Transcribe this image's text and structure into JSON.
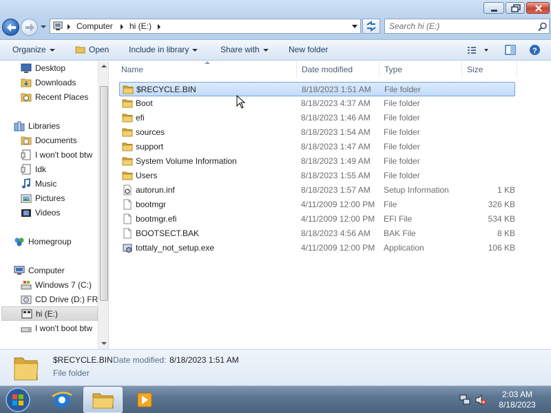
{
  "window": {
    "minimize_icon": "minimize-icon",
    "maximize_icon": "maximize-icon",
    "close_icon": "close-icon"
  },
  "address": {
    "crumbs": [
      "Computer",
      "hi (E:)"
    ],
    "search_placeholder": "Search hi (E:)"
  },
  "toolbar": {
    "organize": "Organize",
    "open": "Open",
    "include_in_library": "Include in library",
    "share_with": "Share with",
    "new_folder": "New folder"
  },
  "nav": {
    "favorites": [
      "Desktop",
      "Downloads",
      "Recent Places"
    ],
    "libraries_label": "Libraries",
    "libraries": [
      "Documents",
      "I won't boot btw",
      "Idk",
      "Music",
      "Pictures",
      "Videos"
    ],
    "homegroup": "Homegroup",
    "computer_label": "Computer",
    "drives": [
      "Windows 7 (C:)",
      "CD Drive (D:) FRT",
      "hi (E:)",
      "I won't boot btw"
    ],
    "selected_drive": "hi (E:)"
  },
  "columns": {
    "name": "Name",
    "date_modified": "Date modified",
    "type": "Type",
    "size": "Size"
  },
  "files": [
    {
      "name": "$RECYCLE.BIN",
      "date": "8/18/2023 1:51 AM",
      "type": "File folder",
      "size": "",
      "icon": "folder-icon"
    },
    {
      "name": "Boot",
      "date": "8/18/2023 4:37 AM",
      "type": "File folder",
      "size": "",
      "icon": "folder-icon"
    },
    {
      "name": "efi",
      "date": "8/18/2023 1:46 AM",
      "type": "File folder",
      "size": "",
      "icon": "folder-icon"
    },
    {
      "name": "sources",
      "date": "8/18/2023 1:54 AM",
      "type": "File folder",
      "size": "",
      "icon": "folder-icon"
    },
    {
      "name": "support",
      "date": "8/18/2023 1:47 AM",
      "type": "File folder",
      "size": "",
      "icon": "folder-icon"
    },
    {
      "name": "System Volume Information",
      "date": "8/18/2023 1:49 AM",
      "type": "File folder",
      "size": "",
      "icon": "folder-icon"
    },
    {
      "name": "Users",
      "date": "8/18/2023 1:55 AM",
      "type": "File folder",
      "size": "",
      "icon": "folder-icon"
    },
    {
      "name": "autorun.inf",
      "date": "8/18/2023 1:57 AM",
      "type": "Setup Information",
      "size": "1 KB",
      "icon": "setup-info-icon"
    },
    {
      "name": "bootmgr",
      "date": "4/11/2009 12:00 PM",
      "type": "File",
      "size": "326 KB",
      "icon": "file-icon"
    },
    {
      "name": "bootmgr.efi",
      "date": "4/11/2009 12:00 PM",
      "type": "EFI File",
      "size": "534 KB",
      "icon": "file-icon"
    },
    {
      "name": "BOOTSECT.BAK",
      "date": "8/18/2023 4:56 AM",
      "type": "BAK File",
      "size": "8 KB",
      "icon": "file-icon"
    },
    {
      "name": "tottaly_not_setup.exe",
      "date": "4/11/2009 12:00 PM",
      "type": "Application",
      "size": "106 KB",
      "icon": "setup-exe-icon"
    }
  ],
  "selected_file": "$RECYCLE.BIN",
  "details": {
    "name": "$RECYCLE.BIN",
    "modified_label": "Date modified:",
    "modified_value": "8/18/2023 1:51 AM",
    "type": "File folder"
  },
  "taskbar": {
    "time": "2:03 AM",
    "date": "8/18/2023",
    "items": [
      "start-orb-icon",
      "internet-explorer-icon",
      "windows-explorer-icon",
      "media-player-icon"
    ]
  },
  "colors": {
    "selection": "#cce4fc",
    "folder": "#e8c25a",
    "secondary_text": "#6d6d6d"
  }
}
